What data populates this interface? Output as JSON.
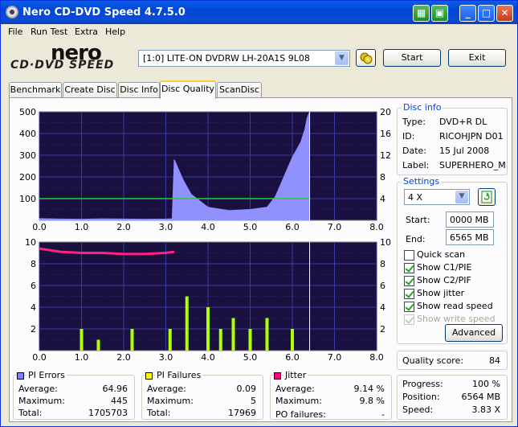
{
  "window": {
    "title": "Nero CD-DVD Speed 4.7.5.0"
  },
  "titlebar_buttons": {
    "minimize": "_",
    "maximize": "□",
    "close": "✕"
  },
  "menu": [
    "File",
    "Run Test",
    "Extra",
    "Help"
  ],
  "logo": {
    "brand": "nero",
    "sub": "CD·DVD SPEED"
  },
  "drive": {
    "selected": "[1:0]  LITE-ON DVDRW LH-20A1S 9L08"
  },
  "buttons": {
    "start": "Start",
    "exit": "Exit",
    "advanced": "Advanced"
  },
  "tabs": [
    "Benchmark",
    "Create Disc",
    "Disc Info",
    "Disc Quality",
    "ScanDisc"
  ],
  "active_tab": "Disc Quality",
  "disc_info": {
    "title": "Disc info",
    "type_label": "Type:",
    "type": "DVD+R DL",
    "id_label": "ID:",
    "id": "RICOHJPN D01",
    "date_label": "Date:",
    "date": "15 Jul 2008",
    "label_label": "Label:",
    "label": "SUPERHERO_M"
  },
  "settings": {
    "title": "Settings",
    "speed": "4 X",
    "start_label": "Start:",
    "start": "0000 MB",
    "end_label": "End:",
    "end": "6565 MB",
    "checks": [
      {
        "label": "Quick scan",
        "checked": false,
        "disabled": false
      },
      {
        "label": "Show C1/PIE",
        "checked": true,
        "disabled": false
      },
      {
        "label": "Show C2/PIF",
        "checked": true,
        "disabled": false
      },
      {
        "label": "Show jitter",
        "checked": true,
        "disabled": false
      },
      {
        "label": "Show read speed",
        "checked": true,
        "disabled": false
      },
      {
        "label": "Show write speed",
        "checked": true,
        "disabled": true
      }
    ]
  },
  "quality": {
    "label": "Quality score:",
    "value": "84"
  },
  "progress": {
    "progress_label": "Progress:",
    "progress": "100 %",
    "position_label": "Position:",
    "position": "6564 MB",
    "speed_label": "Speed:",
    "speed": "3.83 X"
  },
  "stats": {
    "pi_errors": {
      "title": "PI Errors",
      "avg_label": "Average:",
      "avg": "64.96",
      "max_label": "Maximum:",
      "max": "445",
      "total_label": "Total:",
      "total": "1705703",
      "color": "#8080ff"
    },
    "pi_failures": {
      "title": "PI Failures",
      "avg_label": "Average:",
      "avg": "0.09",
      "max_label": "Maximum:",
      "max": "5",
      "total_label": "Total:",
      "total": "17969",
      "color": "#ffff00"
    },
    "jitter": {
      "title": "Jitter",
      "avg_label": "Average:",
      "avg": "9.14 %",
      "max_label": "Maximum:",
      "max": "9.8 %",
      "po_label": "PO failures:",
      "po": "-",
      "color": "#ff0080"
    }
  },
  "colors": {
    "plot_bg": "#1a1040",
    "grid": "#3a3aa0",
    "pie": "#9090ff",
    "pif": "#b0ff00",
    "jitter": "#ff2080",
    "speed": "#20d040",
    "marker": "#ffffff"
  },
  "chart_data": [
    {
      "type": "area",
      "x_ticks": [
        "0.0",
        "1.0",
        "2.0",
        "3.0",
        "4.0",
        "5.0",
        "6.0",
        "7.0",
        "8.0"
      ],
      "y_ticks_left": [
        "500",
        "400",
        "300",
        "200",
        "100"
      ],
      "y_ticks_right": [
        "20",
        "16",
        "12",
        "8",
        "4"
      ],
      "xlim": [
        0,
        8
      ],
      "ylim_left": [
        0,
        500
      ],
      "ylim_right": [
        0,
        20
      ],
      "series": [
        {
          "x": [
            0,
            0.5,
            1,
            1.5,
            2,
            2.5,
            3,
            3.15,
            3.2,
            3.4,
            3.6,
            3.8,
            4,
            4.5,
            5,
            5.4,
            5.6,
            5.8,
            6,
            6.2,
            6.3,
            6.35,
            6.41
          ],
          "values": [
            8,
            6,
            5,
            7,
            6,
            5,
            6,
            7,
            280,
            190,
            120,
            90,
            60,
            45,
            50,
            60,
            110,
            200,
            290,
            360,
            420,
            470,
            500
          ]
        },
        {
          "x": [
            0,
            1,
            2,
            3,
            4,
            5,
            6,
            6.41
          ],
          "values": [
            4,
            4,
            4,
            4,
            4,
            4,
            4,
            4
          ]
        }
      ],
      "end_marker_x": 6.41
    },
    {
      "type": "bar",
      "x_ticks": [
        "0.0",
        "1.0",
        "2.0",
        "3.0",
        "4.0",
        "5.0",
        "6.0",
        "7.0",
        "8.0"
      ],
      "y_ticks_left": [
        "10",
        "8",
        "6",
        "4",
        "2"
      ],
      "y_ticks_right": [
        "10",
        "8",
        "6",
        "4",
        "2"
      ],
      "xlim": [
        0,
        8
      ],
      "ylim": [
        0,
        10
      ],
      "series": [
        {
          "x": [
            0,
            0.5,
            1,
            1.5,
            2,
            2.5,
            3,
            3.2
          ],
          "values": [
            9.4,
            9.1,
            9.0,
            9.0,
            8.9,
            8.9,
            9.0,
            9.1
          ]
        },
        {
          "x": [
            1,
            1.4,
            2.2,
            3.1,
            3.5,
            4,
            4.3,
            4.6,
            5,
            5.4,
            6
          ],
          "values": [
            2,
            1,
            2,
            2,
            5,
            4,
            2,
            3,
            2,
            3,
            2
          ]
        }
      ],
      "end_marker_x": 6.41
    }
  ]
}
